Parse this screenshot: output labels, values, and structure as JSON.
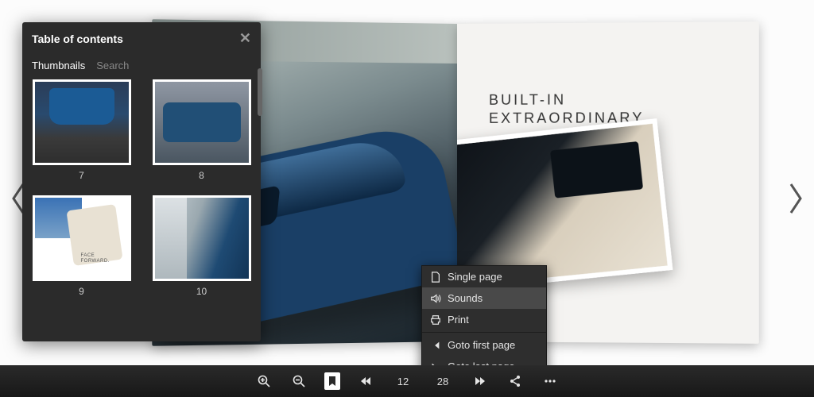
{
  "toc": {
    "title": "Table of contents",
    "tabs": {
      "thumbnails": "Thumbnails",
      "search": "Search"
    },
    "pages": [
      {
        "num": "7"
      },
      {
        "num": "8"
      },
      {
        "num": "9",
        "caption_line1": "FACE",
        "caption_line2": "FORWARD."
      },
      {
        "num": "10"
      }
    ]
  },
  "brochure": {
    "headline_line1": "BUILT-IN",
    "headline_line2": "EXTRAORDINARY."
  },
  "context_menu": {
    "single_page": "Single page",
    "sounds": "Sounds",
    "print": "Print",
    "goto_first": "Goto first page",
    "goto_last": "Goto last page"
  },
  "toolbar": {
    "page_left": "12",
    "page_right": "28"
  }
}
